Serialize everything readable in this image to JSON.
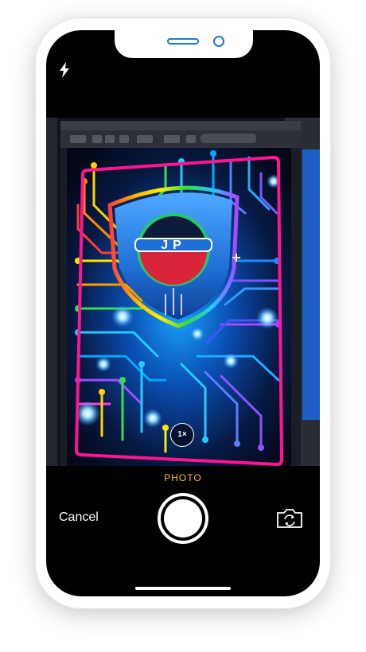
{
  "camera": {
    "mode_label": "PHOTO",
    "cancel_label": "Cancel",
    "zoom_label": "1×"
  },
  "icons": {
    "flash": "flash-icon",
    "shutter": "shutter-button",
    "switch_camera": "switch-camera-icon",
    "zoom": "zoom-toggle"
  },
  "viewfinder": {
    "menubar_items": [
      "Preview",
      "File",
      "Edit",
      "View",
      "Go",
      "Tools"
    ],
    "window_title": "jp_label_1.png",
    "search_placeholder": "Search",
    "logo_text": "JP"
  },
  "colors": {
    "accent_yellow": "#f5c518",
    "frame_pink": "#ff1493",
    "shield_blue": "#1f6fd6",
    "logo_red": "#d9253a",
    "logo_green": "#1fb141"
  }
}
